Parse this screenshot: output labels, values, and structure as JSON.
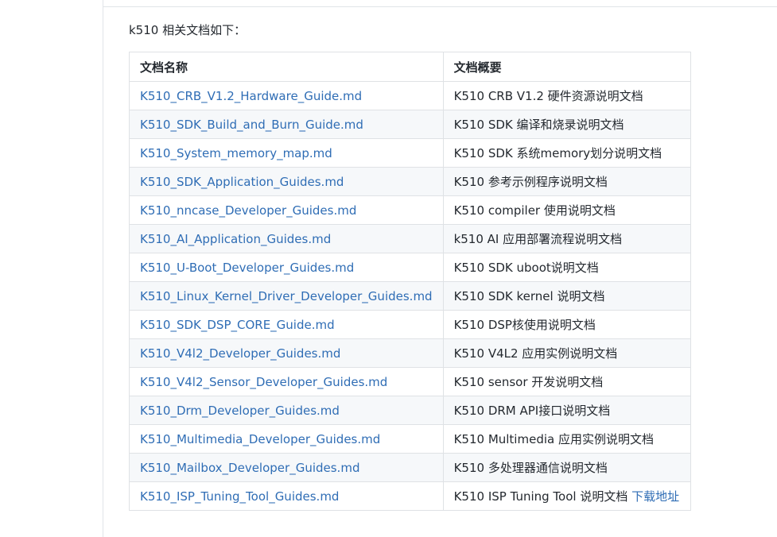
{
  "intro_text": "k510 相关文档如下：",
  "table": {
    "headers": [
      "文档名称",
      "文档概要"
    ],
    "rows": [
      {
        "name": "K510_CRB_V1.2_Hardware_Guide.md",
        "summary": "K510 CRB V1.2 硬件资源说明文档"
      },
      {
        "name": "K510_SDK_Build_and_Burn_Guide.md",
        "summary": "K510 SDK 编译和烧录说明文档"
      },
      {
        "name": "K510_System_memory_map.md",
        "summary": "K510 SDK 系统memory划分说明文档"
      },
      {
        "name": "K510_SDK_Application_Guides.md",
        "summary": "K510 参考示例程序说明文档"
      },
      {
        "name": "K510_nncase_Developer_Guides.md",
        "summary": "K510 compiler 使用说明文档"
      },
      {
        "name": "K510_AI_Application_Guides.md",
        "summary": "k510 AI 应用部署流程说明文档"
      },
      {
        "name": "K510_U-Boot_Developer_Guides.md",
        "summary": "K510 SDK uboot说明文档"
      },
      {
        "name": "K510_Linux_Kernel_Driver_Developer_Guides.md",
        "summary": "K510 SDK kernel 说明文档"
      },
      {
        "name": "K510_SDK_DSP_CORE_Guide.md",
        "summary": "K510 DSP核使用说明文档"
      },
      {
        "name": "K510_V4l2_Developer_Guides.md",
        "summary": "K510 V4L2 应用实例说明文档"
      },
      {
        "name": "K510_V4l2_Sensor_Developer_Guides.md",
        "summary": "K510 sensor 开发说明文档"
      },
      {
        "name": "K510_Drm_Developer_Guides.md",
        "summary": "K510 DRM API接口说明文档"
      },
      {
        "name": "K510_Multimedia_Developer_Guides.md",
        "summary": "K510 Multimedia 应用实例说明文档"
      },
      {
        "name": "K510_Mailbox_Developer_Guides.md",
        "summary": "K510 多处理器通信说明文档"
      },
      {
        "name": "K510_ISP_Tuning_Tool_Guides.md",
        "summary": "K510 ISP Tuning Tool 说明文档",
        "extra_link": "下载地址"
      }
    ]
  }
}
